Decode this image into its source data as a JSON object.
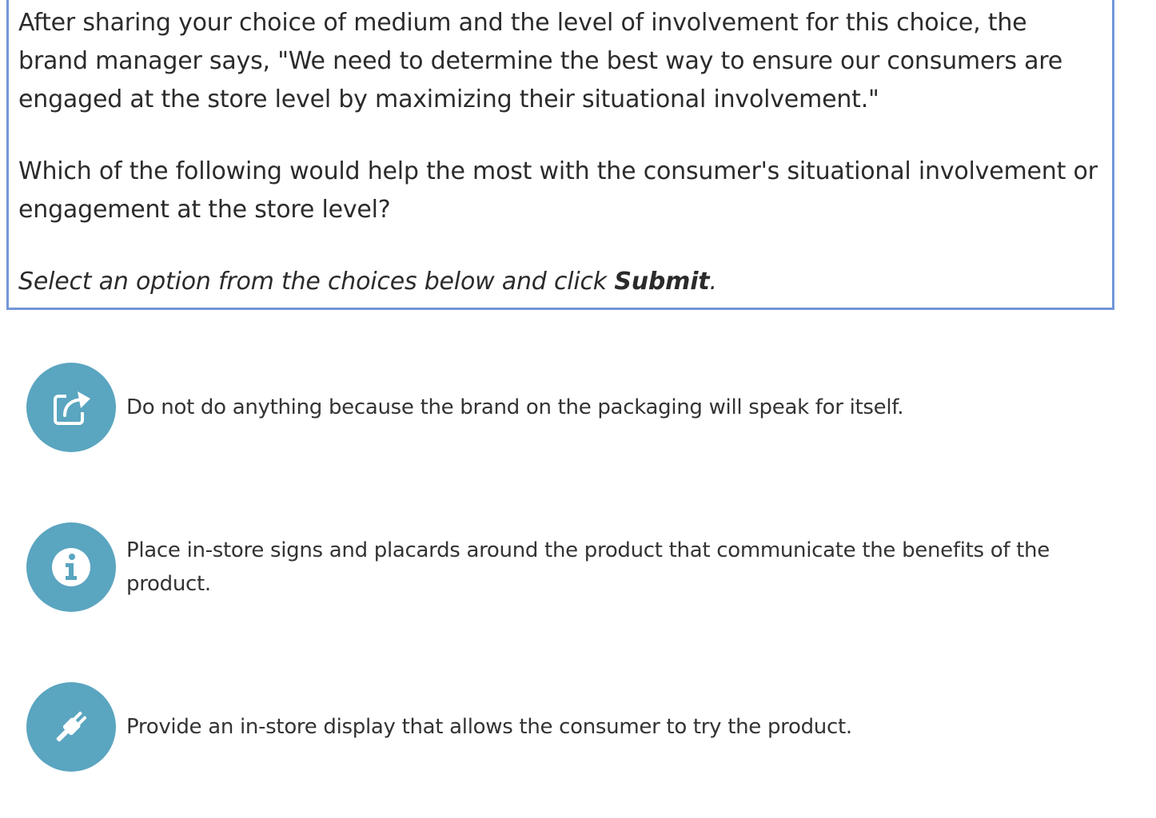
{
  "question": {
    "context": "After sharing your choice of medium and the level of involvement for this choice, the brand manager says, \"We need to determine the best way to ensure our consumers are engaged at the store level by maximizing their situational involvement.\"",
    "prompt": "Which of the following would help the most with the consumer's situational involvement or engagement at the store level?",
    "instruction_prefix": "Select an option from the choices below and click ",
    "instruction_action": "Submit",
    "instruction_suffix": "."
  },
  "options": [
    {
      "icon": "external-link-icon",
      "label": "Do not do anything because the brand on the packaging will speak for itself."
    },
    {
      "icon": "info-icon",
      "label": "Place in-store signs and placards around the product that communicate the benefits of the product."
    },
    {
      "icon": "plug-icon",
      "label": "Provide an in-store display that allows the consumer to try the product."
    }
  ],
  "colors": {
    "box_border": "#7296d8",
    "icon_circle": "#5aa5c0",
    "text": "#2b2b2b"
  }
}
